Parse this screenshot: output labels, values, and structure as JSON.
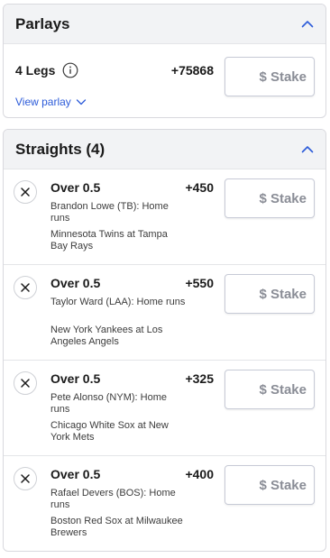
{
  "parlays": {
    "title": "Parlays",
    "legs_label": "4 Legs",
    "odds": "+75868",
    "view_label": "View parlay",
    "stake_placeholder": "$ Stake"
  },
  "straights": {
    "title": "Straights (4)",
    "bets": [
      {
        "title": "Over 0.5",
        "odds": "+450",
        "player": "Brandon Lowe (TB): Home runs",
        "game": "Minnesota Twins at Tampa Bay Rays",
        "stake_placeholder": "$ Stake"
      },
      {
        "title": "Over 0.5",
        "odds": "+550",
        "player": "Taylor Ward (LAA): Home runs",
        "game": "New York Yankees at Los Angeles Angels",
        "stake_placeholder": "$ Stake"
      },
      {
        "title": "Over 0.5",
        "odds": "+325",
        "player": "Pete Alonso (NYM): Home runs",
        "game": "Chicago White Sox at New York Mets",
        "stake_placeholder": "$ Stake"
      },
      {
        "title": "Over 0.5",
        "odds": "+400",
        "player": "Rafael Devers (BOS): Home runs",
        "game": "Boston Red Sox at Milwaukee Brewers",
        "stake_placeholder": "$ Stake"
      }
    ]
  },
  "icons": {
    "collapse": "chevron-up-icon",
    "expand": "chevron-down-icon",
    "info": "info-icon",
    "remove": "close-icon"
  },
  "colors": {
    "accent": "#2c5bd9",
    "header_bg": "#f2f3f5",
    "stake_text": "#8a8d96"
  }
}
